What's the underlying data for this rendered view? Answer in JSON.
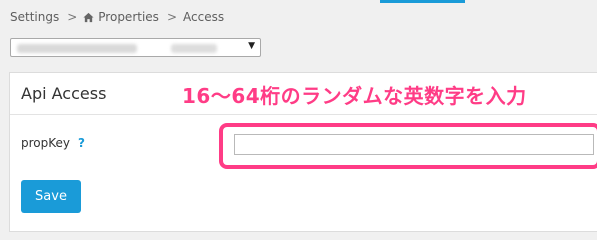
{
  "breadcrumb": {
    "items": [
      {
        "label": "Settings"
      },
      {
        "label": "Properties",
        "icon": "home-icon"
      },
      {
        "label": "Access"
      }
    ],
    "separator": ">"
  },
  "property_select": {
    "arrow": "▼"
  },
  "panel": {
    "title": "Api Access",
    "annotation": "16〜64桁のランダムな英数字を入力"
  },
  "form": {
    "field_label": "propKey",
    "help": "?",
    "value": "",
    "save_label": "Save"
  },
  "colors": {
    "accent": "#1a9bd8",
    "highlight": "#ff3c86"
  }
}
